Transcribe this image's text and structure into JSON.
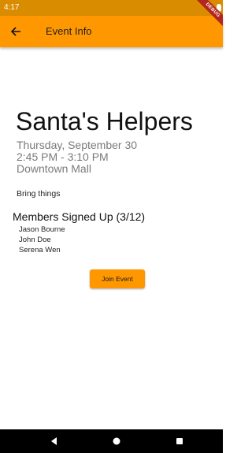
{
  "status_bar": {
    "time": "4:17",
    "debug_label": "DEBUG"
  },
  "app_bar": {
    "title": "Event Info",
    "back_icon": "arrow-left-icon"
  },
  "event": {
    "title": "Santa's Helpers",
    "date": "Thursday, September 30",
    "time": "2:45 PM - 3:10 PM",
    "location": "Downtown Mall",
    "description": "Bring things"
  },
  "members": {
    "heading": "Members Signed Up (3/12)",
    "names": [
      "Jason Bourne",
      "John Doe",
      "Serena Wen"
    ]
  },
  "actions": {
    "join_label": "Join Event"
  },
  "nav_bar": {
    "icons": [
      "back-triangle-icon",
      "home-circle-icon",
      "recents-square-icon"
    ]
  },
  "colors": {
    "status_bar": "#d98c00",
    "app_bar": "#ff9800",
    "button": "#ff9800",
    "nav_bar": "#000000",
    "secondary_text": "#7a7a7a"
  }
}
